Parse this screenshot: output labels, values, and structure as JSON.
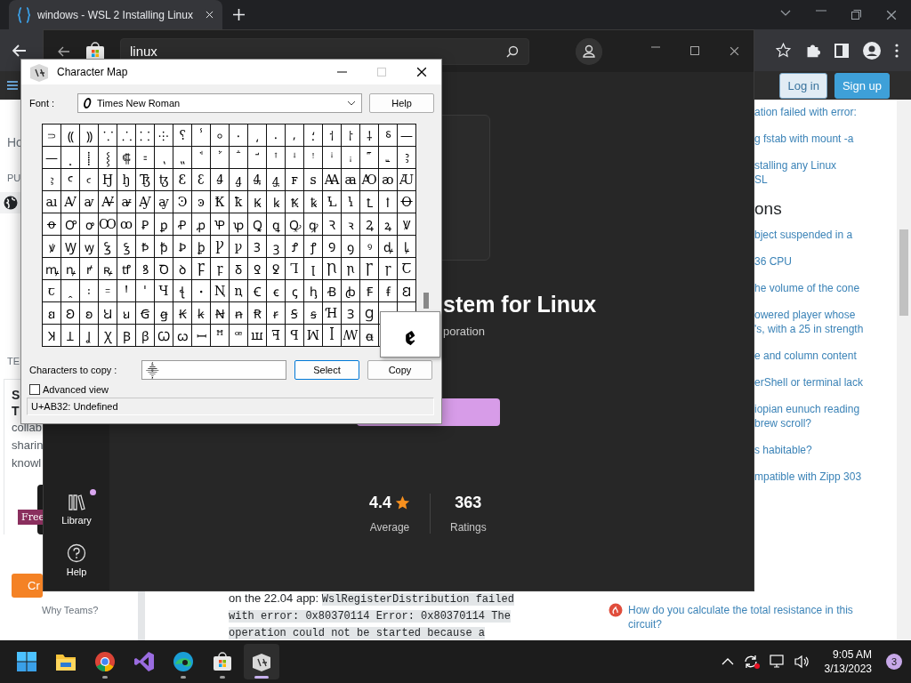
{
  "browser": {
    "tab": {
      "title": "windows - WSL 2 Installing Linux"
    }
  },
  "webpage": {
    "header": {
      "login": "Log in",
      "signup": "Sign up"
    },
    "left_sidebar": {
      "home": "Ho",
      "section": "PU",
      "teams_section": "TE",
      "teams_title": [
        "S",
        "T"
      ],
      "teams_text": [
        "collab",
        "sharin",
        "knowl"
      ],
      "badge": "Free",
      "cta": "Cr",
      "why": "Why Teams?"
    },
    "post": {
      "text": "on the 22.04 app:",
      "code": "WslRegisterDistribution failed with error: 0x80370114 Error: 0x80370114 The operation could not be started because a"
    },
    "right_sidebar": {
      "links_top": [
        "ation failed with error:",
        "g fstab with mount -a",
        "stalling any Linux\nSL"
      ],
      "heading": "ons",
      "links": [
        "bject suspended in a",
        "36 CPU",
        "he volume of the cone",
        "owered player whose\n's, with a 25 in strength",
        "e and column content",
        "erShell or terminal lack",
        "iopian eunuch reading\nbrew scroll?",
        "s habitable?",
        "mpatible with Zipp 303"
      ],
      "hot": "How do you calculate the total resistance in this circuit?"
    }
  },
  "store": {
    "search": {
      "value": "linux"
    },
    "nav": [
      {
        "label": "Library",
        "kind": "library",
        "badge": true
      },
      {
        "label": "Help",
        "kind": "help",
        "badge": false
      }
    ],
    "app": {
      "title": "stem for Linux",
      "publisher": "poration"
    },
    "rating": {
      "value": "4.4",
      "label": "Average"
    },
    "ratings": {
      "value": "363",
      "label": "Ratings"
    }
  },
  "charmap": {
    "title": "Character Map",
    "font_label": "Font :",
    "font": "Times New Roman",
    "help": "Help",
    "grid": [
      [
        "⸧",
        "⸨",
        "⸩",
        "⸪",
        "⸫",
        "⸬",
        "⸭",
        "⸮",
        "ⸯ",
        "⸰",
        "⸱",
        "⸲",
        "⸳",
        "⸴",
        "⸵",
        "⸶",
        "⸷",
        "⸸",
        "⸹",
        "—"
      ],
      [
        "—",
        "⸼",
        "⸽",
        "⸾",
        "⸿",
        "⹀",
        "⹁",
        "⹂",
        "ꜗ",
        "ꜘ",
        "ꜙ",
        "ꜚ",
        "ꜛ",
        "ꜜ",
        "ꜝ",
        "ꜞ",
        "ꜟ",
        "꜠",
        "꜡",
        "Ꜣ"
      ],
      [
        "ꜣ",
        "Ꜥ",
        "ꜥ",
        "Ꜧ",
        "ꜧ",
        "Ꜩ",
        "ꜩ",
        "Ꜫ",
        "ꜫ",
        "Ꜭ",
        "ꜭ",
        "Ꜯ",
        "ꜯ",
        "ꜰ",
        "ꜱ",
        "Ꜳ",
        "ꜳ",
        "Ꜵ",
        "ꜵ",
        "Ꜷ"
      ],
      [
        "ꜷ",
        "Ꜹ",
        "ꜹ",
        "Ꜻ",
        "ꜻ",
        "Ꜽ",
        "ꜽ",
        "Ꜿ",
        "ꜿ",
        "Ꝁ",
        "ꝁ",
        "Ꝃ",
        "ꝃ",
        "Ꝅ",
        "ꝅ",
        "Ꝇ",
        "ꝇ",
        "Ꝉ",
        "ꝉ",
        "Ꝋ"
      ],
      [
        "ꝋ",
        "Ꝍ",
        "ꝍ",
        "Ꝏ",
        "ꝏ",
        "Ꝑ",
        "ꝑ",
        "Ꝓ",
        "ꝓ",
        "Ꝕ",
        "ꝕ",
        "Ꝗ",
        "ꝗ",
        "Ꝙ",
        "ꝙ",
        "Ꝛ",
        "ꝛ",
        "Ꝝ",
        "ꝝ",
        "Ꝟ"
      ],
      [
        "ꝟ",
        "Ꝡ",
        "ꝡ",
        "Ꝣ",
        "ꝣ",
        "Ꝥ",
        "ꝥ",
        "Ꝧ",
        "ꝧ",
        "Ꝩ",
        "ꝩ",
        "Ꝫ",
        "ꝫ",
        "Ꝭ",
        "ꝭ",
        "Ꝯ",
        "ꝯ",
        "ꝰ",
        "ꝱ",
        "ꝲ"
      ],
      [
        "ꝳ",
        "ꝴ",
        "ꝵ",
        "ꝶ",
        "ꝷ",
        "ꝸ",
        "Ꝺ",
        "ꝺ",
        "Ꝼ",
        "ꝼ",
        "Ᵹ",
        "Ꝿ",
        "ꝿ",
        "Ꞁ",
        "ꞁ",
        "Ꞃ",
        "ꞃ",
        "Ꞅ",
        "ꞅ",
        "Ꞇ"
      ],
      [
        "ꞇ",
        "ꞈ",
        "꞉",
        "꞊",
        "Ꞌ",
        "ꞌ",
        "Ɥ",
        "ꞎ",
        "ꞏ",
        "Ꞑ",
        "ꞑ",
        "Ꞓ",
        "ꞓ",
        "ꞔ",
        "ꞕ",
        "Ꞗ",
        "ꞗ",
        "Ꞙ",
        "ꞙ",
        "Ꞛ"
      ],
      [
        "ꞛ",
        "Ꞝ",
        "ꞝ",
        "Ꞟ",
        "ꞟ",
        "Ꞡ",
        "ꞡ",
        "Ꞣ",
        "ꞣ",
        "Ꞥ",
        "ꞥ",
        "Ꞧ",
        "ꞧ",
        "Ꞩ",
        "ꞩ",
        "Ɦ",
        "Ɜ",
        "Ɡ"
      ],
      [
        "Ʞ",
        "Ʇ",
        "Ʝ",
        "Ꭓ",
        "Ꞵ",
        "ꞵ",
        "Ꞷ",
        "ꞷ",
        "ꟷ",
        "ꟸ",
        "ꟹ",
        "ꟺ",
        "ꟻ",
        "ꟼ",
        "ꟽ",
        "ꟾ",
        "ꟿ",
        "ꬰ"
      ]
    ],
    "preview": "ꬲ",
    "copy_label": "Characters to copy :",
    "copy_value": "⸎",
    "select": "Select",
    "copy": "Copy",
    "advanced": {
      "label": "Advanced view",
      "checked": false
    },
    "status": "U+AB32: Undefined"
  },
  "taskbar": {
    "apps": [
      {
        "kind": "start",
        "running": false,
        "active": false
      },
      {
        "kind": "folder",
        "running": false,
        "active": false
      },
      {
        "kind": "chrome",
        "running": true,
        "active": false
      },
      {
        "kind": "vs",
        "running": false,
        "active": false
      },
      {
        "kind": "edge",
        "running": true,
        "active": false
      },
      {
        "kind": "store",
        "running": true,
        "active": false
      },
      {
        "kind": "charmap",
        "running": true,
        "active": true
      }
    ],
    "time": "9:05 AM",
    "date": "3/13/2023",
    "notifications": "3"
  }
}
